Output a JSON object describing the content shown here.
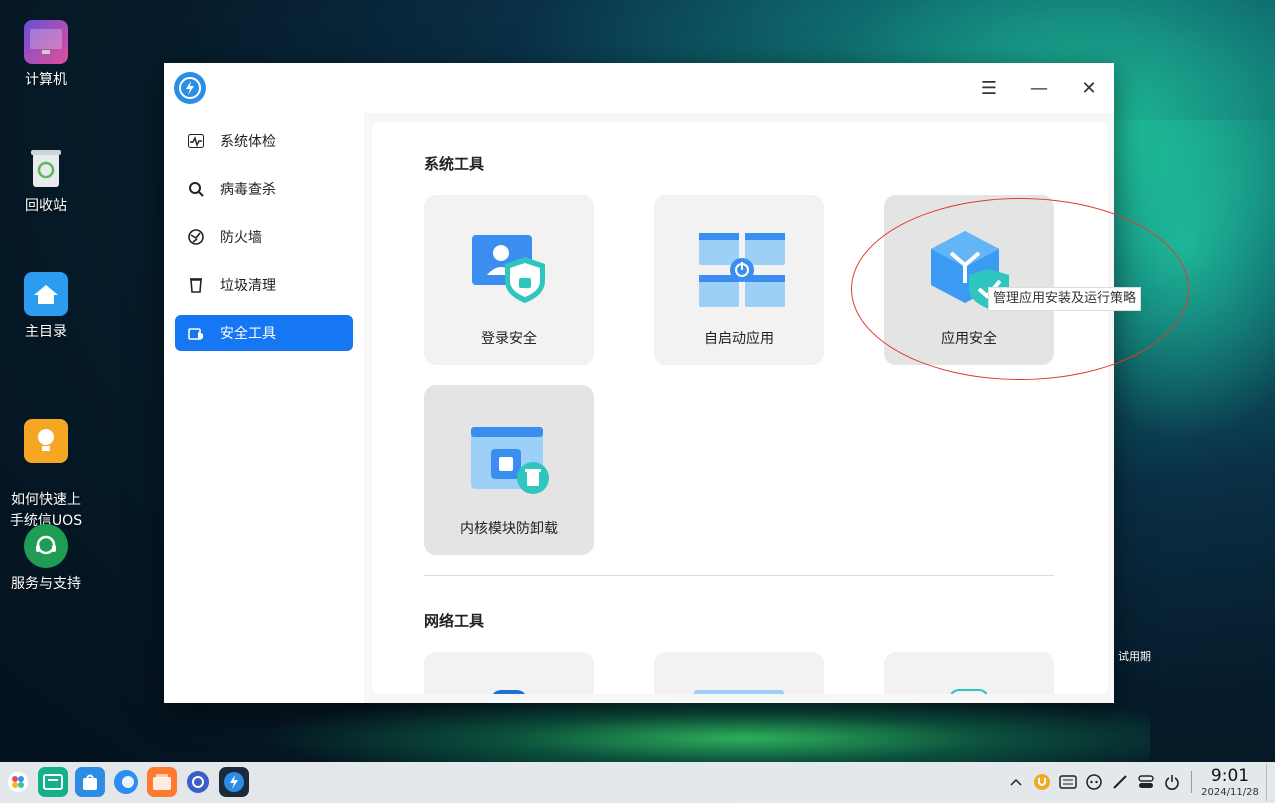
{
  "desktop": {
    "icons": [
      {
        "label": "计算机"
      },
      {
        "label": "回收站"
      },
      {
        "label": "主目录"
      },
      {
        "label": "如何快速上\n手统信UOS"
      },
      {
        "label": "服务与支持"
      }
    ],
    "trial_label": "试用期"
  },
  "window": {
    "controls": {
      "menu": "☰",
      "minimize": "—",
      "close": "✕"
    },
    "sidebar": {
      "items": [
        {
          "label": "系统体检",
          "icon": "pulse-icon"
        },
        {
          "label": "病毒查杀",
          "icon": "virus-scan-icon"
        },
        {
          "label": "防火墙",
          "icon": "firewall-icon"
        },
        {
          "label": "垃圾清理",
          "icon": "trash-icon"
        },
        {
          "label": "安全工具",
          "icon": "toolbox-icon",
          "active": true
        }
      ]
    },
    "main": {
      "section_system": "系统工具",
      "cards": [
        {
          "label": "登录安全",
          "icon": "login-shield-icon"
        },
        {
          "label": "自启动应用",
          "icon": "autostart-icon"
        },
        {
          "label": "应用安全",
          "icon": "app-shield-icon"
        },
        {
          "label": "内核模块防卸载",
          "icon": "kernel-module-icon"
        }
      ],
      "tooltip": "管理应用安装及运行策略",
      "section_network": "网络工具"
    }
  },
  "taskbar": {
    "time": "9:01",
    "date": "2024/11/28"
  },
  "colors": {
    "accent": "#1677f5",
    "annotation": "#e23a2e"
  }
}
